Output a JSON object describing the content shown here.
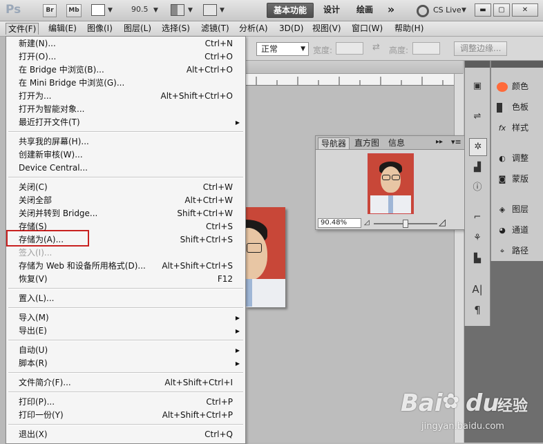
{
  "appbar": {
    "logo": "Ps",
    "br": "Br",
    "mb": "Mb",
    "zoom": "90.5",
    "workspaces": [
      "基本功能",
      "设计",
      "绘画"
    ],
    "more": "»",
    "cslive": "CS Live"
  },
  "menubar": [
    "文件(F)",
    "编辑(E)",
    "图像(I)",
    "图层(L)",
    "选择(S)",
    "滤镜(T)",
    "分析(A)",
    "3D(D)",
    "视图(V)",
    "窗口(W)",
    "帮助(H)"
  ],
  "options": {
    "style": "正常",
    "width_label": "宽度:",
    "height_label": "高度:",
    "refine": "调整边缘..."
  },
  "navigator": {
    "tabs": [
      "导航器",
      "直方图",
      "信息"
    ],
    "zoom": "90.48%"
  },
  "dock": {
    "panels": [
      {
        "label": "颜色"
      },
      {
        "label": "色板"
      },
      {
        "label": "样式"
      },
      {
        "label": "调整"
      },
      {
        "label": "蒙版"
      },
      {
        "label": "图层"
      },
      {
        "label": "通道"
      },
      {
        "label": "路径"
      }
    ]
  },
  "file_menu": {
    "items": [
      {
        "label": "新建(N)...",
        "shortcut": "Ctrl+N"
      },
      {
        "label": "打开(O)...",
        "shortcut": "Ctrl+O"
      },
      {
        "label": "在 Bridge 中浏览(B)...",
        "shortcut": "Alt+Ctrl+O"
      },
      {
        "label": "在 Mini Bridge 中浏览(G)...",
        "shortcut": ""
      },
      {
        "label": "打开为...",
        "shortcut": "Alt+Shift+Ctrl+O"
      },
      {
        "label": "打开为智能对象...",
        "shortcut": ""
      },
      {
        "label": "最近打开文件(T)",
        "shortcut": "",
        "submenu": true
      },
      {
        "label": "共享我的屏幕(H)...",
        "shortcut": ""
      },
      {
        "label": "创建新审核(W)...",
        "shortcut": ""
      },
      {
        "label": "Device Central...",
        "shortcut": ""
      },
      {
        "label": "关闭(C)",
        "shortcut": "Ctrl+W"
      },
      {
        "label": "关闭全部",
        "shortcut": "Alt+Ctrl+W"
      },
      {
        "label": "关闭并转到 Bridge...",
        "shortcut": "Shift+Ctrl+W"
      },
      {
        "label": "存储(S)",
        "shortcut": "Ctrl+S"
      },
      {
        "label": "存储为(A)...",
        "shortcut": "Shift+Ctrl+S"
      },
      {
        "label": "签入(I)...",
        "shortcut": "",
        "disabled": true
      },
      {
        "label": "存储为 Web 和设备所用格式(D)...",
        "shortcut": "Alt+Shift+Ctrl+S"
      },
      {
        "label": "恢复(V)",
        "shortcut": "F12"
      },
      {
        "label": "置入(L)...",
        "shortcut": ""
      },
      {
        "label": "导入(M)",
        "shortcut": "",
        "submenu": true
      },
      {
        "label": "导出(E)",
        "shortcut": "",
        "submenu": true
      },
      {
        "label": "自动(U)",
        "shortcut": "",
        "submenu": true
      },
      {
        "label": "脚本(R)",
        "shortcut": "",
        "submenu": true
      },
      {
        "label": "文件简介(F)...",
        "shortcut": "Alt+Shift+Ctrl+I"
      },
      {
        "label": "打印(P)...",
        "shortcut": "Ctrl+P"
      },
      {
        "label": "打印一份(Y)",
        "shortcut": "Alt+Shift+Ctrl+P"
      },
      {
        "label": "退出(X)",
        "shortcut": "Ctrl+Q"
      }
    ]
  },
  "watermark": {
    "brand": "Bai",
    "brand2": "du",
    "jingyan": "经验",
    "url": "jingyan.baidu.com"
  },
  "colors": {
    "highlight_box": "#c8201f",
    "photo_bg": "#c84738",
    "dock_dark": "#6e6e6e"
  }
}
